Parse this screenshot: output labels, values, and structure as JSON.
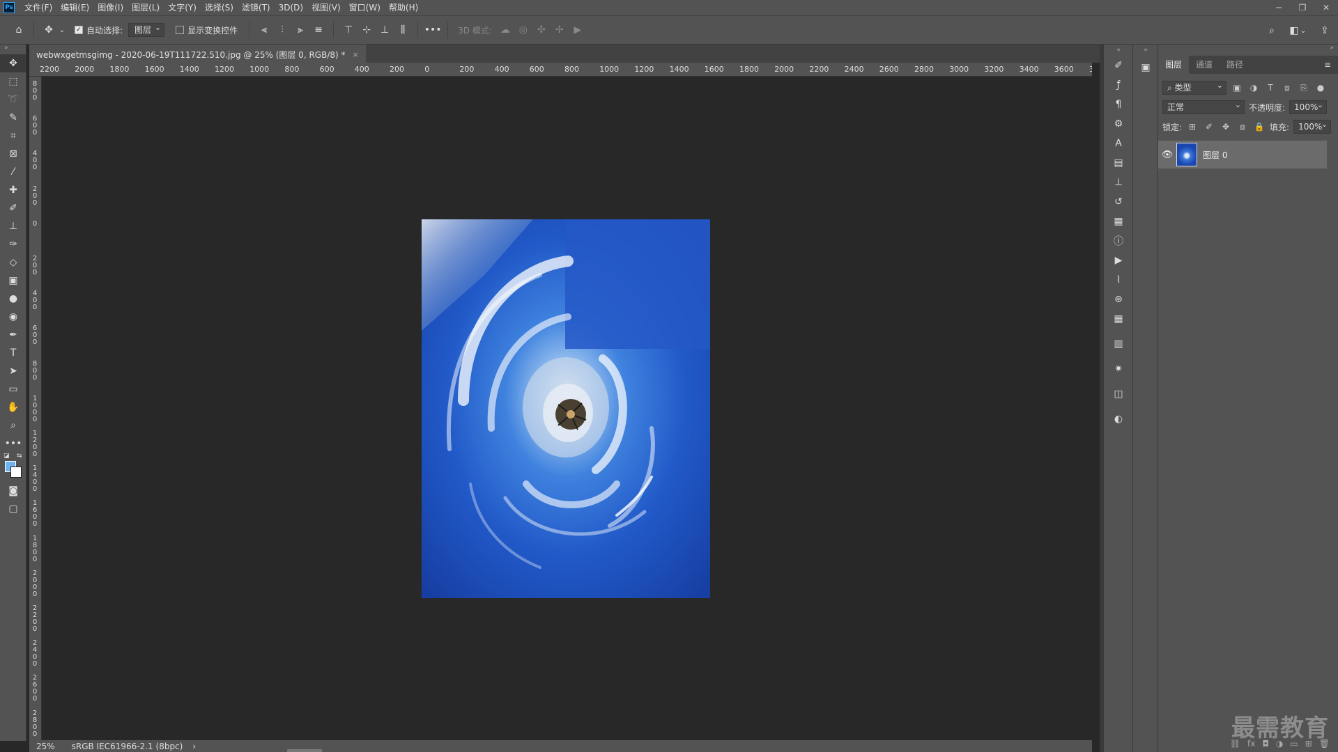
{
  "app": {
    "logo": "Ps",
    "menu": [
      "文件(F)",
      "编辑(E)",
      "图像(I)",
      "图层(L)",
      "文字(Y)",
      "选择(S)",
      "滤镜(T)",
      "3D(D)",
      "视图(V)",
      "窗口(W)",
      "帮助(H)"
    ],
    "window_controls": [
      "─",
      "❐",
      "✕"
    ]
  },
  "options": {
    "auto_select_label": "自动选择:",
    "auto_select_value": "图层",
    "show_transform_label": "显示变换控件",
    "more": "•••",
    "mode_3d_label": "3D 模式:"
  },
  "document": {
    "tab_title": "webwxgetmsgimg - 2020-06-19T111722.510.jpg @ 25% (图层 0, RGB/8) *",
    "close": "×",
    "colors": {
      "foreground": "#6fb3ef",
      "background": "#ffffff"
    }
  },
  "ruler": {
    "h_labels": [
      "2200",
      "2000",
      "1800",
      "1600",
      "1400",
      "1200",
      "1000",
      "800",
      "600",
      "400",
      "200",
      "0",
      "200",
      "400",
      "600",
      "800",
      "1000",
      "1200",
      "1400",
      "1600",
      "1800",
      "2000",
      "2200",
      "2400",
      "2600",
      "2800",
      "3000",
      "3200",
      "3400",
      "3600",
      "3"
    ],
    "v_labels": [
      "800",
      "600",
      "400",
      "200",
      "0",
      "200",
      "400",
      "600",
      "800",
      "1000",
      "1200",
      "1400",
      "1600",
      "1800",
      "2000",
      "2200",
      "2400",
      "2600",
      "2800"
    ]
  },
  "status": {
    "zoom": "25%",
    "profile": "sRGB IEC61966-2.1 (8bpc)",
    "arrow": "›"
  },
  "layers_panel": {
    "tabs": [
      "图层",
      "通道",
      "路径"
    ],
    "filter_label": "类型",
    "blend_mode": "正常",
    "opacity_label": "不透明度:",
    "opacity_value": "100%",
    "lock_label": "锁定:",
    "fill_label": "填充:",
    "fill_value": "100%",
    "layer_name": "图层 0",
    "footer_icons": [
      "⛓",
      "fx",
      "◘",
      "◑",
      "▭",
      "⊞",
      "🗑"
    ]
  },
  "watermark": "最需教育"
}
